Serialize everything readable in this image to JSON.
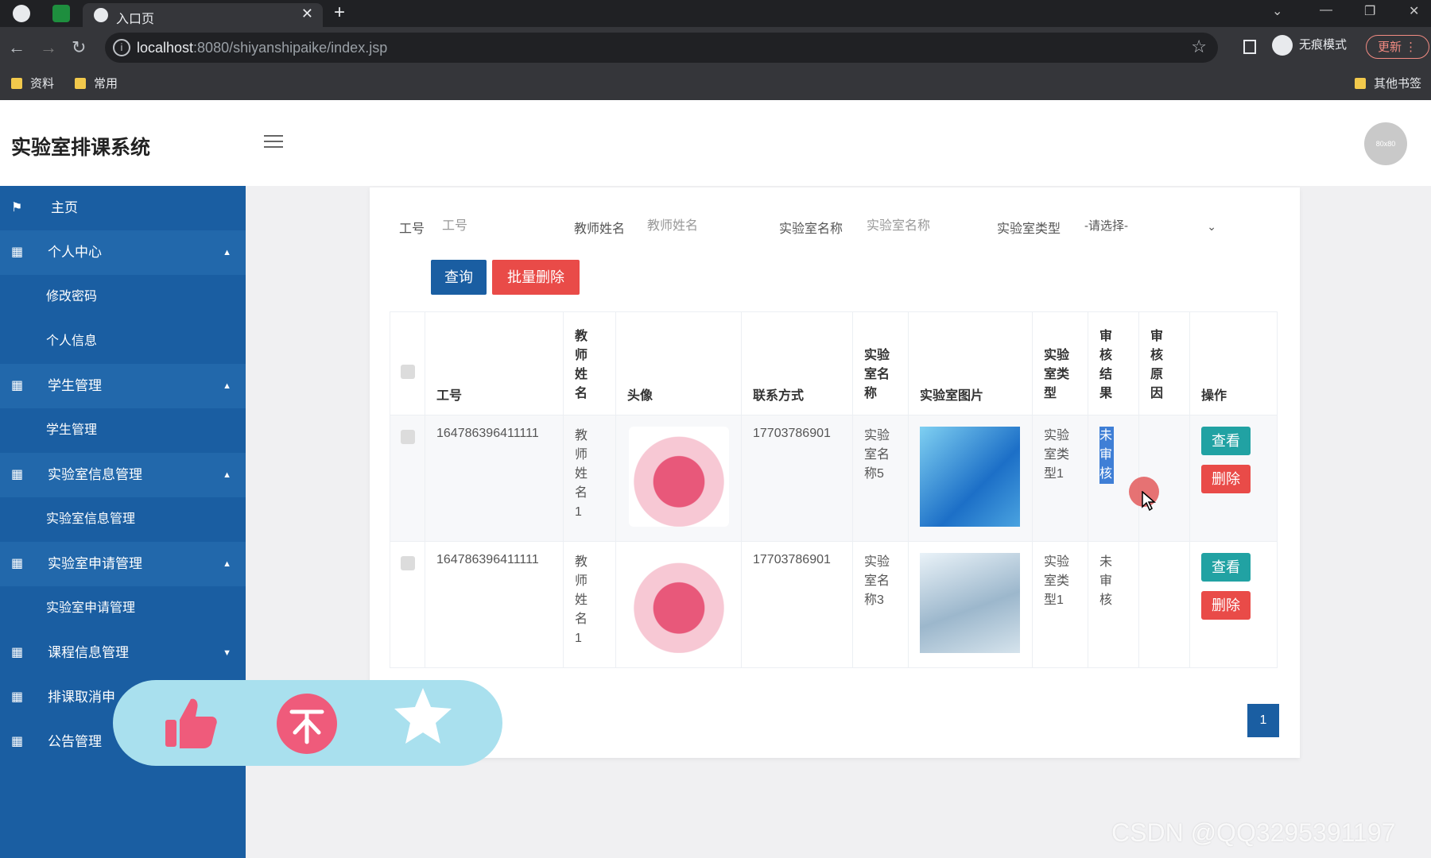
{
  "browser": {
    "tab_title": "入口页",
    "new_tab_symbol": "+",
    "url_host": "localhost",
    "url_rest": ":8080/shiyanshipaike/index.jsp",
    "incognito_label": "无痕模式",
    "update_label": "更新",
    "bookmarks": [
      "资料",
      "常用"
    ],
    "other_bookmarks": "其他书签"
  },
  "app": {
    "title": "实验室排课系统",
    "avatar_text": "80x80"
  },
  "sidebar": {
    "home": "主页",
    "groups": [
      {
        "label": "个人中心",
        "children": [
          "修改密码",
          "个人信息"
        ]
      },
      {
        "label": "学生管理",
        "children": [
          "学生管理"
        ]
      },
      {
        "label": "实验室信息管理",
        "children": [
          "实验室信息管理"
        ]
      },
      {
        "label": "实验室申请管理",
        "children": [
          "实验室申请管理"
        ]
      },
      {
        "label": "课程信息管理",
        "children": []
      },
      {
        "label": "排课取消申",
        "children": []
      },
      {
        "label": "公告管理",
        "children": []
      }
    ]
  },
  "filters": {
    "job_no_label": "工号",
    "job_no_placeholder": "工号",
    "teacher_label": "教师姓名",
    "teacher_placeholder": "教师姓名",
    "lab_name_label": "实验室名称",
    "lab_name_placeholder": "实验室名称",
    "lab_type_label": "实验室类型",
    "lab_type_value": "-请选择-"
  },
  "actions": {
    "search": "查询",
    "batch_delete": "批量删除"
  },
  "table": {
    "headers": [
      "工号",
      "教师姓名",
      "头像",
      "联系方式",
      "实验室名称",
      "实验室图片",
      "实验室类型",
      "审核结果",
      "审核原因",
      "操作"
    ],
    "rows": [
      {
        "job_no": "164786396411111",
        "teacher": "教师姓名1",
        "phone": "17703786901",
        "lab_name": "实验室名称5",
        "lab_type": "实验室类型1",
        "audit_result": "未审核",
        "audit_reason": "",
        "view": "查看",
        "delete": "删除"
      },
      {
        "job_no": "164786396411111",
        "teacher": "教师姓名1",
        "phone": "17703786901",
        "lab_name": "实验室名称3",
        "lab_type": "实验室类型1",
        "audit_result": "未审核",
        "audit_reason": "",
        "view": "查看",
        "delete": "删除"
      }
    ]
  },
  "pagination": {
    "current": "1"
  },
  "watermark": "CSDN @QQ3295391197",
  "colors": {
    "sidebar": "#1a5ea2",
    "primary": "#1a5ea2",
    "danger": "#e94b48",
    "info": "#21a2a3"
  }
}
